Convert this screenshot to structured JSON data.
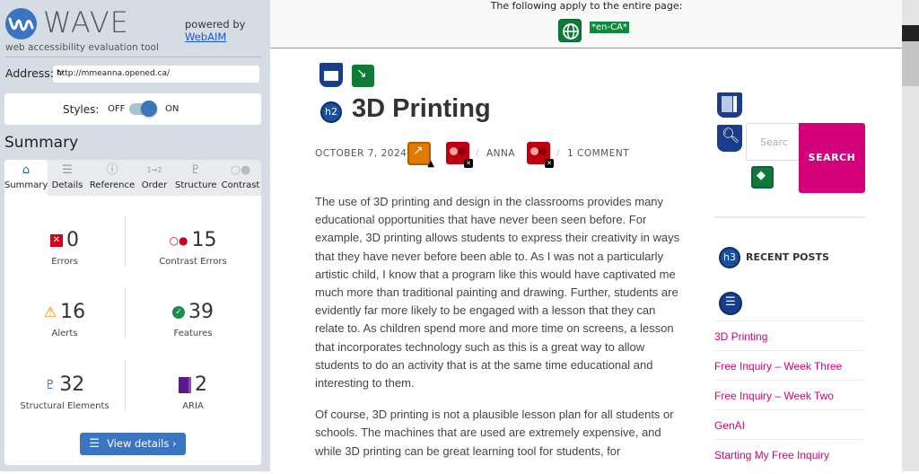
{
  "wave": {
    "logo_text": "WAVE",
    "logo_subtitle": "web accessibility evaluation tool",
    "powered_by": "powered by",
    "webaim_link": "WebAIM",
    "address_label": "Address:",
    "address_value": "http://mmeanna.opened.ca/",
    "styles_label": "Styles:",
    "styles_off": "OFF",
    "styles_on": "ON",
    "styles_enabled": true,
    "summary_title": "Summary",
    "tabs": [
      {
        "label": "Summary",
        "icon": "home-icon",
        "active": true
      },
      {
        "label": "Details",
        "icon": "list-icon"
      },
      {
        "label": "Reference",
        "icon": "info-icon"
      },
      {
        "label": "Order",
        "icon": "order-icon"
      },
      {
        "label": "Structure",
        "icon": "structure-icon"
      },
      {
        "label": "Contrast",
        "icon": "contrast-icon"
      }
    ],
    "stats": {
      "errors": {
        "count": "0",
        "label": "Errors",
        "color": "#d0021b"
      },
      "contrast_errors": {
        "count": "15",
        "label": "Contrast Errors",
        "color": "#d0021b"
      },
      "alerts": {
        "count": "16",
        "label": "Alerts",
        "color": "#f08a00"
      },
      "features": {
        "count": "39",
        "label": "Features",
        "color": "#1e8a4c"
      },
      "structural": {
        "count": "32",
        "label": "Structural Elements",
        "color": "#3b74c0"
      },
      "aria": {
        "count": "2",
        "label": "ARIA",
        "color": "#5a1a8a"
      }
    },
    "view_details": "View details ›"
  },
  "page_header": {
    "text": "The following apply to the entire page:",
    "lang": "*en-CA*"
  },
  "post": {
    "title": "3D Printing",
    "date": "OCTOBER 7, 2024",
    "author": "ANNA",
    "comments": "1 COMMENT",
    "slash": "/",
    "paragraphs": [
      "The use of 3D printing and design in the classrooms provides many educational opportunities that have never been seen before. For example, 3D printing allows students to express their creativity in ways that they have never before been able to. As I was not a particularly artistic child, I know that a program like this would have captivated me much more than traditional painting and drawing. Further, students are evidently far more likely to be engaged with a lesson that they can relate to. As children spend more and more time on screens, a lesson that incorporates technology such as this is a great way to allow students to do an activity that is at the same time educational and interesting to them.",
      "Of course, 3D printing is not a plausible lesson plan for all students or schools. The machines that are used are extremely expensive, and while 3D printing can be great learning tool for students, for"
    ]
  },
  "sidebar_widget": {
    "search_placeholder": "Search",
    "search_button": "SEARCH",
    "recent_title": "RECENT POSTS",
    "recent_posts": [
      "3D Printing",
      "Free Inquiry – Week Three",
      "Free Inquiry – Week Two",
      "GenAI",
      "Starting My Free Inquiry"
    ]
  },
  "badges": {
    "h2": "h2",
    "h3": "h3"
  },
  "colors": {
    "accent_pink": "#d4007a",
    "wave_blue": "#3b74c0"
  }
}
